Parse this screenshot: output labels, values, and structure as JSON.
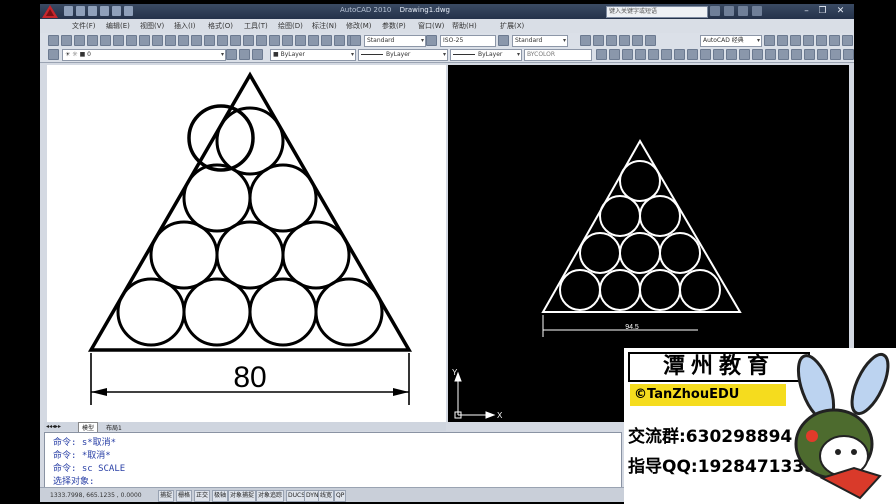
{
  "window": {
    "app_title": "AutoCAD 2010",
    "doc_title": "Drawing1.dwg",
    "search_placeholder": "键入关键字或短语"
  },
  "menus": [
    "文件(F)",
    "编辑(E)",
    "视图(V)",
    "插入(I)",
    "格式(O)",
    "工具(T)",
    "绘图(D)",
    "标注(N)",
    "修改(M)",
    "参数(P)",
    "窗口(W)",
    "帮助(H)",
    "扩展(X)"
  ],
  "toolbar": {
    "layer_value": "0",
    "color_value": "ByLayer",
    "linetype_value": "ByLayer",
    "lineweight_value": "ByLayer",
    "plotstyle_value": "BYCOLOR",
    "dimstyle_value": "ISO-25"
  },
  "drawing": {
    "dimension_left": "80",
    "dimension_right": "94.5",
    "ucs_x": "X",
    "ucs_y": "Y"
  },
  "layout_tabs": [
    "模型",
    "布局1"
  ],
  "command_lines": [
    "命令: s*取消*",
    "命令: *取消*",
    "命令: sc SCALE",
    "选择对象:"
  ],
  "status": {
    "coords": "1333.7998, 665.1235 , 0.0000",
    "buttons": [
      "捕捉",
      "栅格",
      "正交",
      "极轴",
      "对象捕捉",
      "对象追踪",
      "DUCS",
      "DYN",
      "线宽",
      "QP"
    ]
  },
  "watermark": {
    "title": "潭州教育",
    "brand": "©TanZhouEDU",
    "group_line": "交流群:630298894",
    "qq_line": "指导QQ:1928471335"
  }
}
